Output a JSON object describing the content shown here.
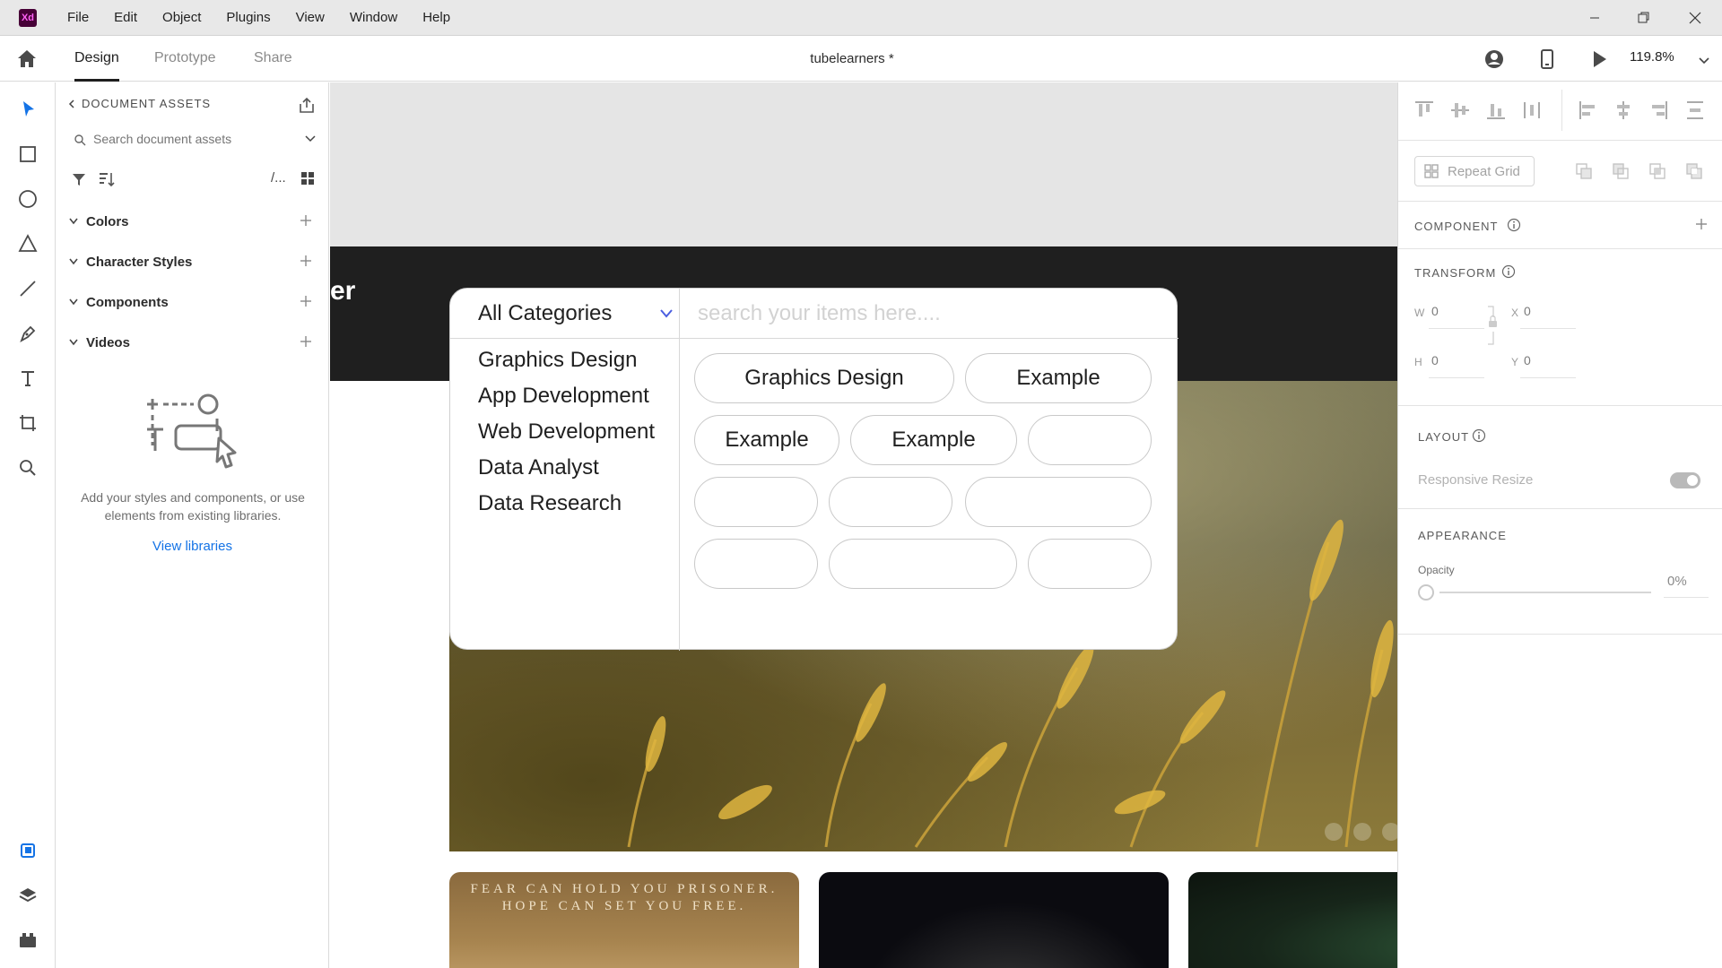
{
  "app": {
    "logo_text": "Xd",
    "menu": [
      "File",
      "Edit",
      "Object",
      "Plugins",
      "View",
      "Window",
      "Help"
    ]
  },
  "topbar": {
    "tabs": [
      "Design",
      "Prototype",
      "Share"
    ],
    "active_tab": "Design",
    "document_title": "tubelearners *",
    "zoom": "119.8%"
  },
  "tools": [
    "select-tool",
    "rectangle-tool",
    "ellipse-tool",
    "polygon-tool",
    "line-tool",
    "pen-tool",
    "text-tool",
    "artboard-tool",
    "zoom-tool",
    "assets-panel",
    "layers-panel",
    "plugins-panel"
  ],
  "assets": {
    "header": "DOCUMENT ASSETS",
    "search_placeholder": "Search document assets",
    "filter_view_text": "/...",
    "sections": [
      "Colors",
      "Character Styles",
      "Components",
      "Videos"
    ],
    "empty_text": "Add your styles and components, or use elements from existing libraries.",
    "view_libraries": "View libraries"
  },
  "canvas": {
    "hero_word": "er",
    "search_widget": {
      "category_select": "All Categories",
      "search_placeholder": "search your items here....",
      "categories": [
        "Graphics Design",
        "App Development",
        "Web Development",
        "Data Analyst",
        "Data Research"
      ],
      "pills": [
        "Graphics Design",
        "Example",
        "Example",
        "Example",
        "",
        "",
        "",
        "",
        "",
        "",
        ""
      ]
    },
    "card_quote_line1": "FEAR CAN HOLD YOU PRISONER.",
    "card_quote_line2": "HOPE CAN SET YOU FREE."
  },
  "properties": {
    "repeat_grid": "Repeat Grid",
    "component_label": "COMPONENT",
    "transform_label": "TRANSFORM",
    "w_label": "W",
    "w_value": "0",
    "h_label": "H",
    "h_value": "0",
    "x_label": "X",
    "x_value": "0",
    "y_label": "Y",
    "y_value": "0",
    "layout_label": "LAYOUT",
    "responsive_resize": "Responsive Resize",
    "appearance_label": "APPEARANCE",
    "opacity_label": "Opacity",
    "opacity_value": "0%"
  },
  "colors": {
    "accent_blue": "#1473e6",
    "xd_logo_bg": "#470137",
    "xd_logo_fg": "#ff61f6",
    "hero_dark": "#1f1f1f"
  }
}
